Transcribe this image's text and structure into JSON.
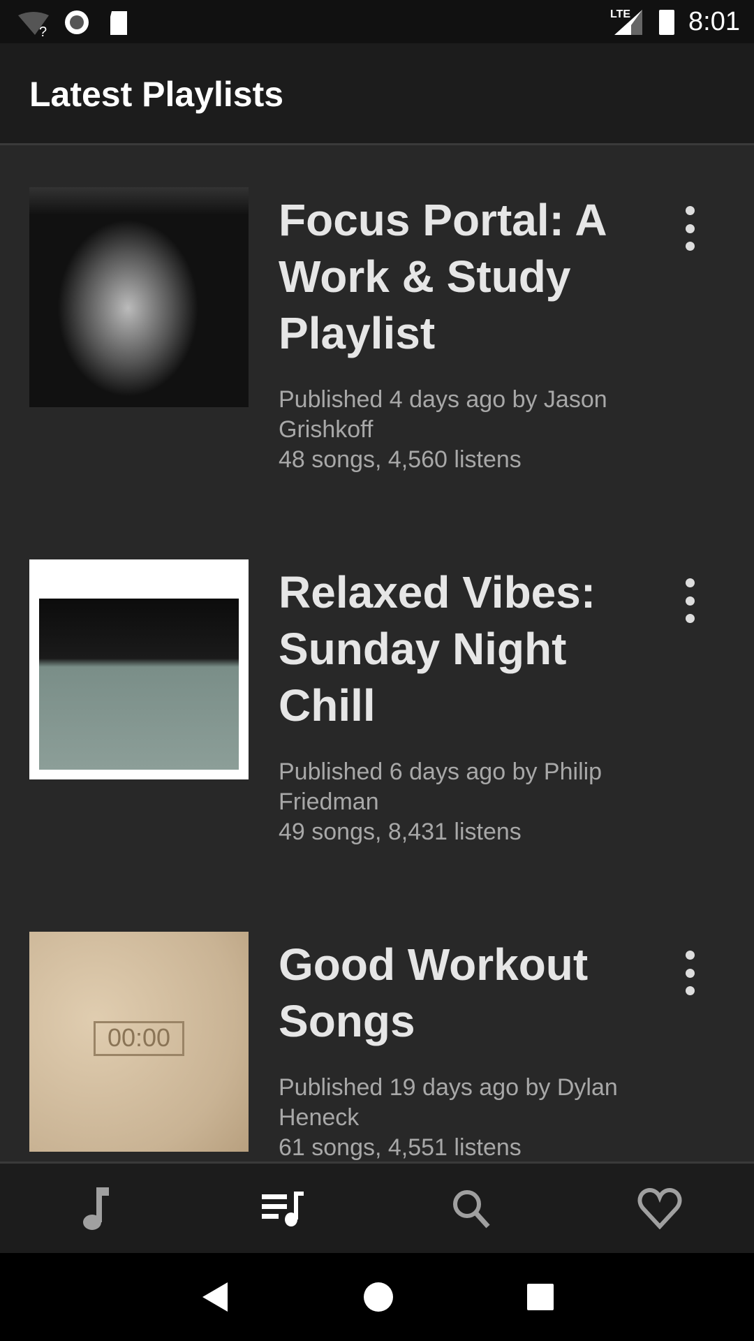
{
  "status_bar": {
    "time": "8:01",
    "network": "LTE",
    "icons": [
      "wifi-unknown-icon",
      "record-icon",
      "sd-card-icon",
      "signal-icon",
      "battery-icon"
    ]
  },
  "header": {
    "title": "Latest Playlists"
  },
  "playlists": [
    {
      "title": "Focus Portal: A Work & Study Playlist",
      "published": "Published 4 days ago by Jason Grishkoff",
      "stats": "48 songs, 4,560 listens"
    },
    {
      "title": "Relaxed Vibes: Sunday Night Chill",
      "published": "Published 6 days ago by Philip Friedman",
      "stats": "49 songs, 8,431 listens"
    },
    {
      "title": "Good Workout Songs",
      "published": "Published 19 days ago by Dylan Heneck",
      "stats": "61 songs, 4,551 listens"
    }
  ],
  "bottom_nav": [
    {
      "icon": "music-note-icon",
      "active": false
    },
    {
      "icon": "playlist-icon",
      "active": true
    },
    {
      "icon": "search-icon",
      "active": false
    },
    {
      "icon": "heart-icon",
      "active": false
    }
  ],
  "colors": {
    "background": "#282828",
    "appbar": "#1c1c1c",
    "active_icon": "#ffffff",
    "inactive_icon": "#a0a0a0"
  }
}
